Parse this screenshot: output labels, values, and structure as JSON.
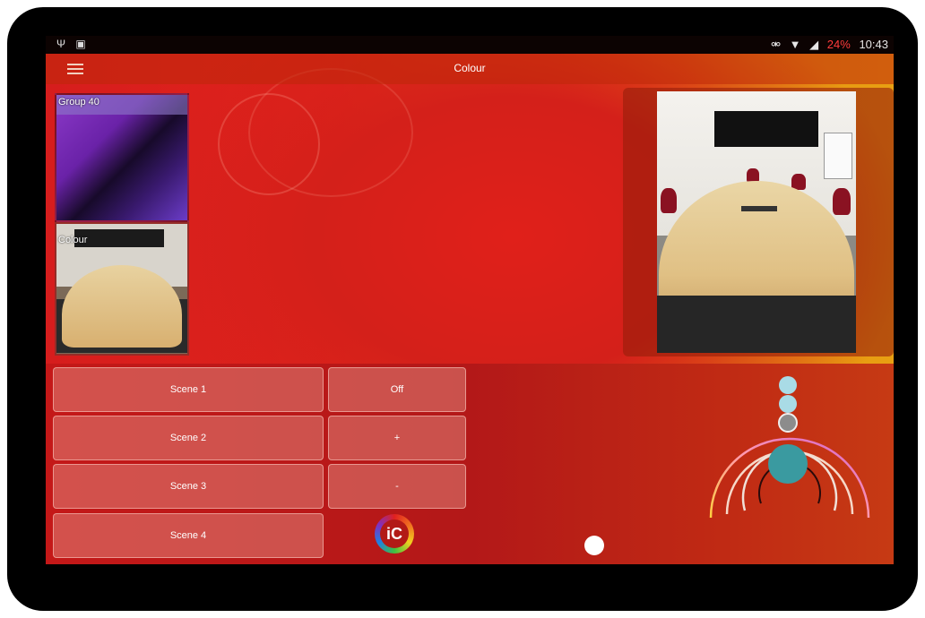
{
  "status_bar": {
    "left_icons": [
      "usb-icon",
      "screenshot-icon"
    ],
    "right_icons": [
      "nfc-icon",
      "wifi-icon",
      "signal-icon"
    ],
    "battery": "24%",
    "time": "10:43"
  },
  "app_bar": {
    "title": "Colour"
  },
  "tiles": [
    {
      "label": "Group 40"
    },
    {
      "label": "Colour"
    }
  ],
  "scenes": [
    {
      "label": "Scene 1"
    },
    {
      "label": "Scene 2"
    },
    {
      "label": "Scene 3"
    },
    {
      "label": "Scene 4"
    }
  ],
  "controls": {
    "off": "Off",
    "up": "+",
    "down": "-"
  },
  "logo_text": "iC",
  "colors": {
    "accent_teal": "#3a9aa0",
    "knob_light": "#a9dbe6",
    "knob_grey": "#8c8c8c"
  }
}
